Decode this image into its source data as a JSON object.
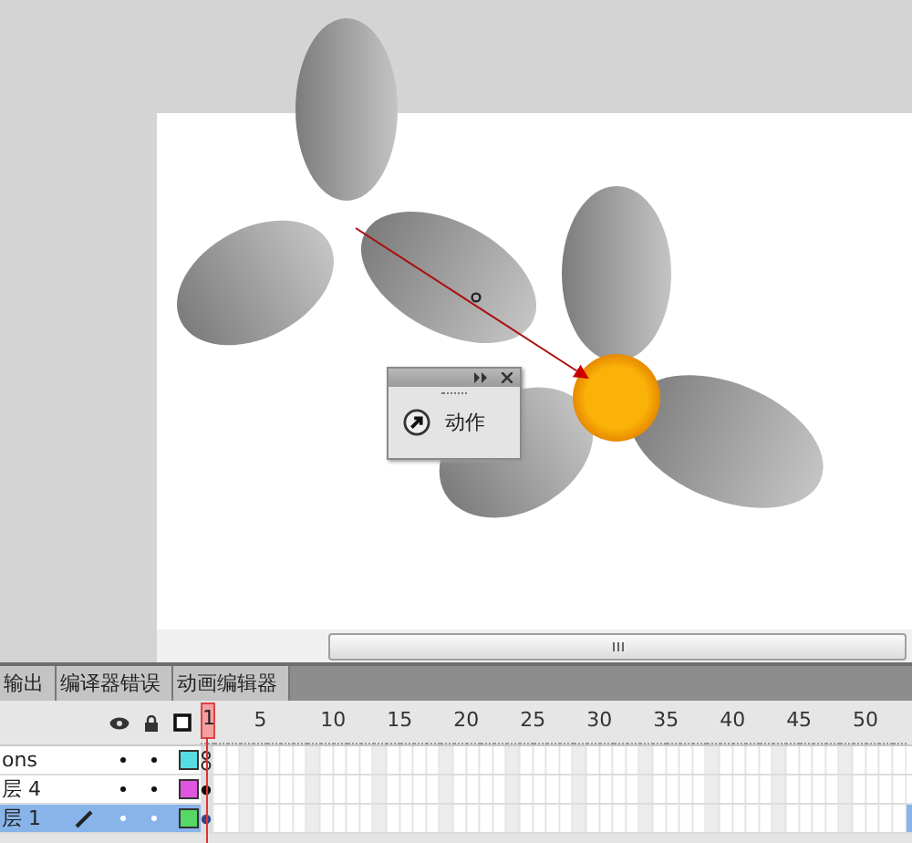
{
  "actions_panel": {
    "label": "动作"
  },
  "panel_tabs": [
    {
      "label": "输出",
      "selected": false
    },
    {
      "label": "编译器错误",
      "selected": false
    },
    {
      "label": "动画编辑器",
      "selected": false
    }
  ],
  "timeline": {
    "frame_numbers": [
      "1",
      "5",
      "10",
      "15",
      "20",
      "25",
      "30",
      "35",
      "40",
      "45",
      "50"
    ],
    "layers": [
      {
        "name": "ons",
        "color": "#55dde0",
        "selected": false,
        "kind": "action"
      },
      {
        "name": "层 4",
        "color": "#e055e0",
        "selected": false,
        "kind": "filled"
      },
      {
        "name": "层 1",
        "color": "#55d865",
        "selected": true,
        "kind": "filled"
      }
    ]
  }
}
